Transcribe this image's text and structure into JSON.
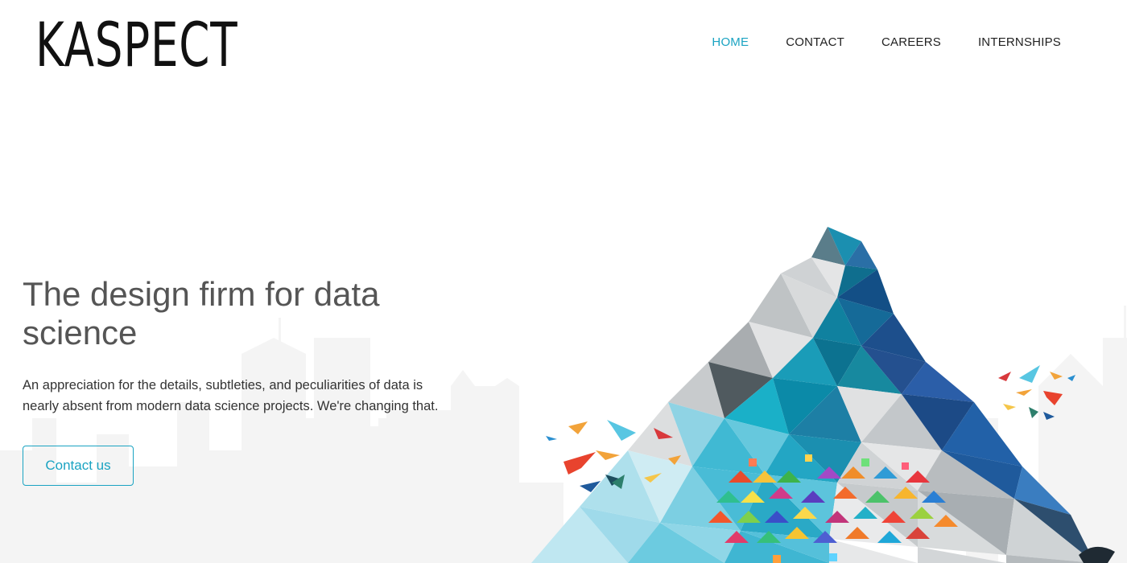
{
  "brand": {
    "logo_text": "KASPECT"
  },
  "nav": {
    "items": [
      {
        "label": "HOME",
        "active": true
      },
      {
        "label": "CONTACT",
        "active": false
      },
      {
        "label": "CAREERS",
        "active": false
      },
      {
        "label": "INTERNSHIPS",
        "active": false
      }
    ]
  },
  "hero": {
    "title": "The design firm for data science",
    "body": "An appreciation for the details, subtleties, and peculiarities of data is nearly absent from modern data science projects. We're changing that.",
    "cta_label": "Contact us"
  },
  "colors": {
    "accent": "#1aa3c2",
    "text_dark": "#222222",
    "skyline": "#f3f3f3"
  }
}
